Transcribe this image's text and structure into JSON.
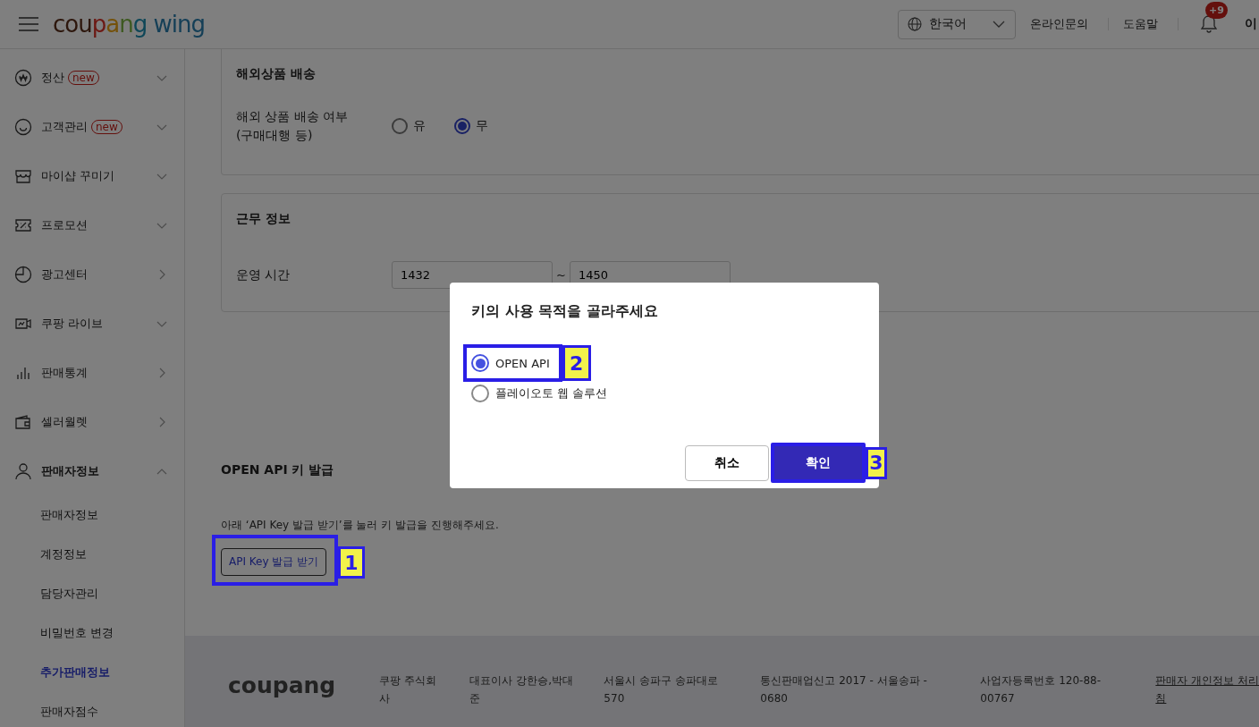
{
  "header": {
    "logo": "coupang wing",
    "language": "한국어",
    "links": [
      "온라인문의",
      "도움말"
    ],
    "notification_badge": "+9",
    "user_name": "이"
  },
  "sidebar": {
    "items": [
      {
        "label": "정산",
        "badge": "new",
        "kind": "group",
        "expanded": false
      },
      {
        "label": "고객관리",
        "badge": "new",
        "kind": "group",
        "expanded": false
      },
      {
        "label": "마이샵 꾸미기",
        "kind": "group",
        "expanded": false
      },
      {
        "label": "프로모션",
        "kind": "group",
        "expanded": false
      },
      {
        "label": "광고센터",
        "kind": "link"
      },
      {
        "label": "쿠팡 라이브",
        "kind": "group",
        "expanded": false
      },
      {
        "label": "판매통계",
        "kind": "link"
      },
      {
        "label": "셀러월렛",
        "kind": "link"
      },
      {
        "label": "판매자정보",
        "kind": "group",
        "expanded": true,
        "children": [
          {
            "label": "판매자정보",
            "selected": false
          },
          {
            "label": "계정정보",
            "selected": false
          },
          {
            "label": "담당자관리",
            "selected": false
          },
          {
            "label": "비밀번호 변경",
            "selected": false
          },
          {
            "label": "추가판매정보",
            "selected": true
          },
          {
            "label": "판매자점수",
            "selected": false
          }
        ]
      }
    ]
  },
  "overseas_section": {
    "title": "해외상품 배송",
    "field_label": [
      "해외 상품 배송 여부",
      "(구매대행 등)"
    ],
    "options": [
      {
        "label": "유",
        "selected": false
      },
      {
        "label": "무",
        "selected": true
      }
    ]
  },
  "work_section": {
    "title": "근무 정보",
    "field_label": "운영 시간",
    "from": "1432",
    "separator": "~",
    "to": "1450"
  },
  "api_section": {
    "title": "OPEN API 키 발급",
    "description": "아래 ‘API Key 발급 받기’를 눌러 키 발급을 진행해주세요.",
    "button": "API Key 발급 받기",
    "annotation": "1"
  },
  "footer": {
    "logo": "coupang",
    "items": [
      [
        "쿠팡 주식회",
        "사"
      ],
      [
        "대표이사 강한승,박대",
        "준"
      ],
      [
        "서울시 송파구 송파대로",
        "570"
      ],
      [
        "통신판매업신고 2017 - 서울송파 -",
        "0680"
      ],
      [
        "사업자등록번호 120-88-",
        "00767"
      ],
      [
        "판매자 개인정보 처리",
        "침"
      ]
    ]
  },
  "modal": {
    "title": "키의 사용 목적을 골라주세요",
    "options": [
      {
        "label": "OPEN API",
        "selected": true,
        "annotation": "2"
      },
      {
        "label": "플레이오토 웹 솔루션",
        "selected": false
      }
    ],
    "cancel": "취소",
    "confirm": "확인",
    "confirm_annotation": "3"
  }
}
